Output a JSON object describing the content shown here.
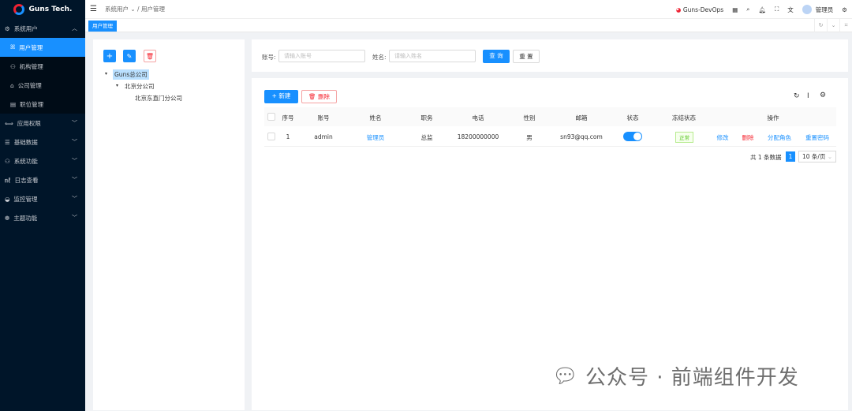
{
  "app": {
    "logo_text": "Guns Tech."
  },
  "sidebar": {
    "items": [
      {
        "label": "系统用户",
        "expanded": true,
        "children": [
          {
            "label": "用户管理",
            "active": true
          },
          {
            "label": "机构管理"
          },
          {
            "label": "公司管理"
          },
          {
            "label": "职位管理"
          }
        ]
      },
      {
        "label": "应用权限"
      },
      {
        "label": "基础数据"
      },
      {
        "label": "系统功能"
      },
      {
        "label": "日志查看"
      },
      {
        "label": "监控管理"
      },
      {
        "label": "主题功能"
      }
    ]
  },
  "header": {
    "breadcrumb": [
      "系统用户 ⌄",
      "/",
      "用户管理"
    ],
    "app_switch": "Guns-DevOps",
    "user": "管理员"
  },
  "tabs": [
    {
      "label": "用户管理"
    }
  ],
  "tree": {
    "root": "Guns总公司",
    "child": "北京分公司",
    "grandchild": "北京东直门分公司"
  },
  "search": {
    "account_label": "账号:",
    "account_placeholder": "请输入账号",
    "name_label": "姓名:",
    "name_placeholder": "请输入姓名",
    "query": "查 询",
    "reset": "重 置"
  },
  "toolbar": {
    "new": "新建",
    "delete": "删除"
  },
  "table": {
    "columns": [
      "序号",
      "账号",
      "姓名",
      "职务",
      "电话",
      "性别",
      "邮箱",
      "状态",
      "冻结状态",
      "操作"
    ],
    "rows": [
      {
        "index": "1",
        "account": "admin",
        "name": "管理员",
        "position": "总监",
        "phone": "18200000000",
        "gender": "男",
        "email": "sn93@qq.com",
        "enabled": true,
        "freeze": "正常",
        "actions": [
          "修改",
          "删除",
          "分配角色",
          "重置密码"
        ]
      }
    ]
  },
  "pagination": {
    "total": "共 1 条数据",
    "page": "1",
    "page_size": "10 条/页"
  },
  "watermark": "公众号 · 前端组件开发"
}
